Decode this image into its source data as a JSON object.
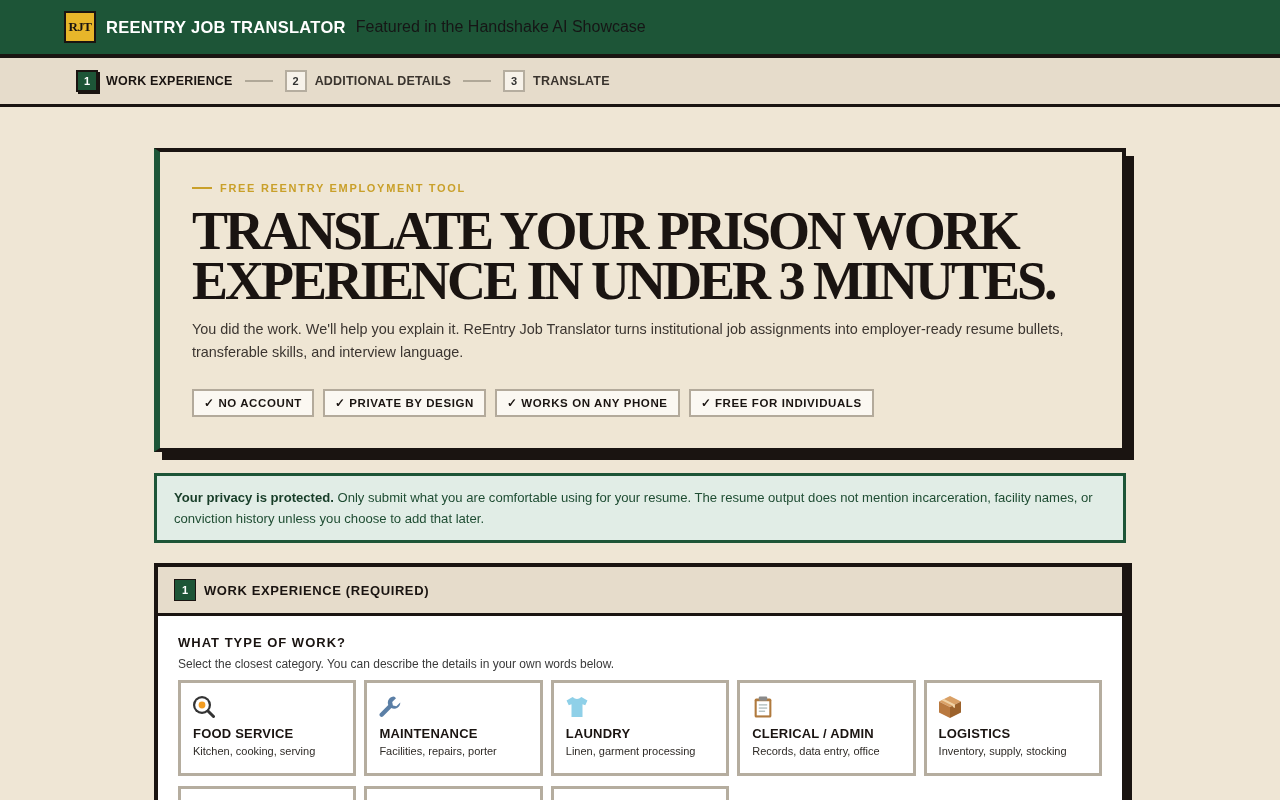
{
  "header": {
    "logo": "RJT",
    "title": "REENTRY JOB TRANSLATOR",
    "tagline": "Featured in the Handshake AI Showcase"
  },
  "steps": [
    {
      "number": "1",
      "label": "WORK EXPERIENCE",
      "selected": true
    },
    {
      "number": "2",
      "label": "ADDITIONAL DETAILS",
      "selected": false
    },
    {
      "number": "3",
      "label": "TRANSLATE",
      "selected": false
    }
  ],
  "hero": {
    "eyebrow": "FREE REENTRY EMPLOYMENT TOOL",
    "heading": "TRANSLATE YOUR PRISON WORK EXPERIENCE IN UNDER 3 MINUTES.",
    "intro": "You did the work. We'll help you explain it. ReEntry Job Translator turns institutional job assignments into employer-ready resume bullets, transferable skills, and interview language.",
    "badges": [
      "✓ NO ACCOUNT",
      "✓ PRIVATE BY DESIGN",
      "✓ WORKS ON ANY PHONE",
      "✓ FREE FOR INDIVIDUALS"
    ]
  },
  "privacy_notice": "**Your privacy is protected.** Only submit what you are comfortable using for your resume. The resume output does not mention incarceration, facility names, or conviction history unless you choose to add that later.",
  "section": {
    "number": "1",
    "title": "WORK EXPERIENCE (REQUIRED)",
    "question": "WHAT TYPE OF WORK?",
    "hint": "Select the closest category. You can describe the details in your own words below.",
    "categories": [
      {
        "kind": "full",
        "title": "FOOD SERVICE",
        "description": "Kitchen, cooking, serving",
        "selected": false
      },
      {
        "kind": "full",
        "title": "MAINTENANCE",
        "description": "Facilities, repairs, porter",
        "selected": false
      },
      {
        "kind": "full",
        "title": "LAUNDRY",
        "description": "Linen, garment processing",
        "selected": false
      },
      {
        "kind": "full",
        "title": "CLERICAL / ADMIN",
        "description": "Records, data entry, office",
        "selected": false
      },
      {
        "kind": "full",
        "title": "LOGISTICS",
        "description": "Inventory, supply, stocking",
        "selected": false
      },
      {
        "kind": "partial",
        "selected": false
      },
      {
        "kind": "partial",
        "selected": false
      },
      {
        "kind": "partial",
        "selected": false
      }
    ]
  }
}
